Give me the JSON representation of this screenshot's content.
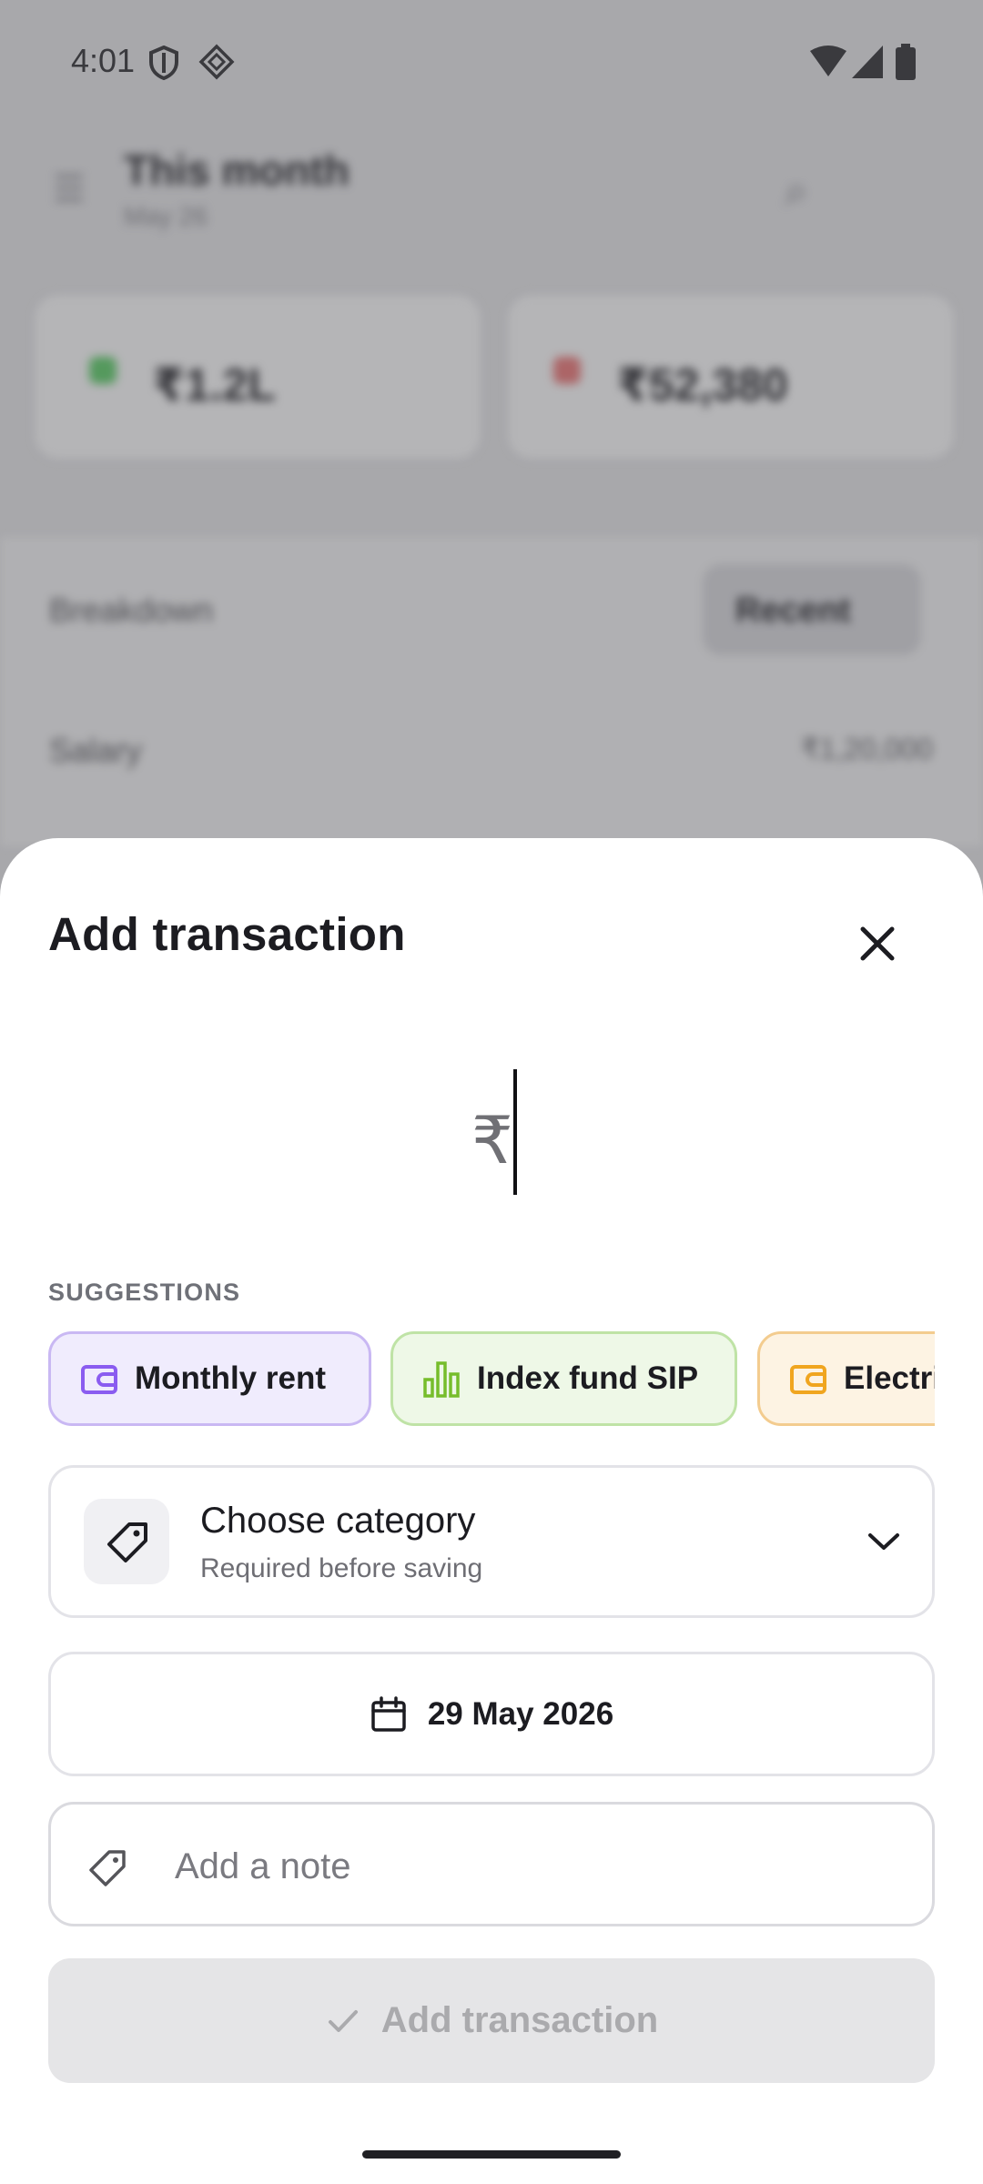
{
  "status_bar": {
    "time": "4:01",
    "icons": [
      "shield-icon",
      "diamond-icon",
      "wifi-icon",
      "cellular-signal-icon",
      "battery-icon"
    ]
  },
  "background": {
    "header_title": "This month",
    "header_subtitle": "May 26",
    "income_amount": "₹1.2L",
    "expense_amount": "₹52,380",
    "row1_label": "Breakdown",
    "row1_button": "Recent",
    "row2_label": "Salary",
    "row2_value": "₹1,20,000"
  },
  "sheet": {
    "title": "Add transaction",
    "currency_symbol": "₹",
    "amount_value": "",
    "suggestions_label": "SUGGESTIONS",
    "suggestions": [
      {
        "label": "Monthly rent",
        "icon": "wallet-icon",
        "bg": "#f0ecfd",
        "border": "#c9b8f3",
        "icon_color": "#8a5cf0"
      },
      {
        "label": "Index fund SIP",
        "icon": "bar-chart-icon",
        "bg": "#eef8e7",
        "border": "#bfe3a6",
        "icon_color": "#76bd2b"
      },
      {
        "label": "Electricity",
        "icon": "wallet-icon",
        "bg": "#fdf3e3",
        "border": "#f3cc8f",
        "icon_color": "#f0a51f"
      }
    ],
    "category": {
      "title": "Choose category",
      "subtitle": "Required before saving"
    },
    "date": "29 May 2026",
    "note_placeholder": "Add a note",
    "note_value": "",
    "submit_label": "Add transaction"
  },
  "colors": {
    "sheet_bg": "#ffffff",
    "disabled_button_bg": "#e5e5e7",
    "disabled_button_text": "#aaaaad",
    "field_border": "#e3e3e8"
  }
}
